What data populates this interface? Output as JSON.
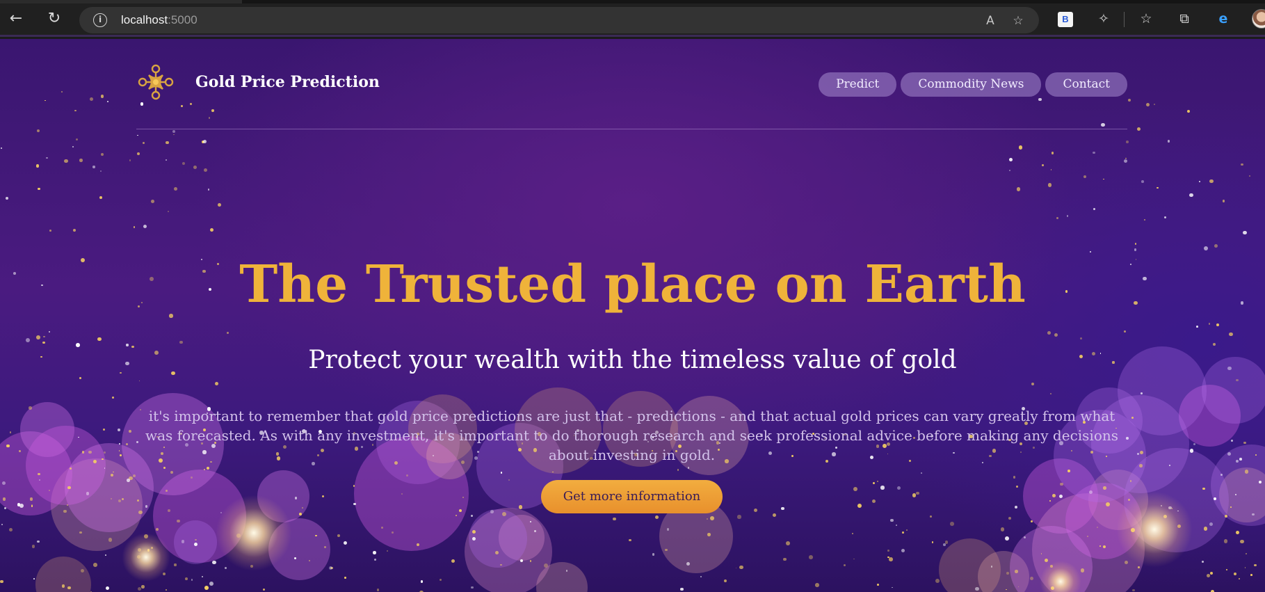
{
  "browser": {
    "url_host": "localhost",
    "url_port": ":5000",
    "toolbar_icons": [
      "back-arrow-icon",
      "refresh-icon",
      "info-icon",
      "read-aloud-icon",
      "add-favorite-icon",
      "bing-icon",
      "extensions-icon",
      "favorites-icon",
      "collections-icon",
      "edge-icon",
      "profile-avatar"
    ],
    "read_aloud_glyph": "A",
    "bing_glyph": "B",
    "edge_glyph": "e"
  },
  "site": {
    "brand": "Gold Price Prediction",
    "nav": [
      {
        "label": "Predict"
      },
      {
        "label": "Commodity News"
      },
      {
        "label": "Contact"
      }
    ]
  },
  "hero": {
    "title": "The Trusted place on Earth",
    "subtitle": "Protect your wealth with the timeless value of gold",
    "body": "it's important to remember that gold price predictions are just that - predictions - and that actual gold prices can vary greatly from what was forecasted. As with any investment, it's important to do thorough research and seek professional advice before making any decisions about investing in gold.",
    "cta_label": "Get more information"
  },
  "colors": {
    "title_gold": "#efb33a",
    "cta_orange": "#ee9f35",
    "background_purple": "#4a1b80",
    "nav_pill": "#a996cf"
  }
}
